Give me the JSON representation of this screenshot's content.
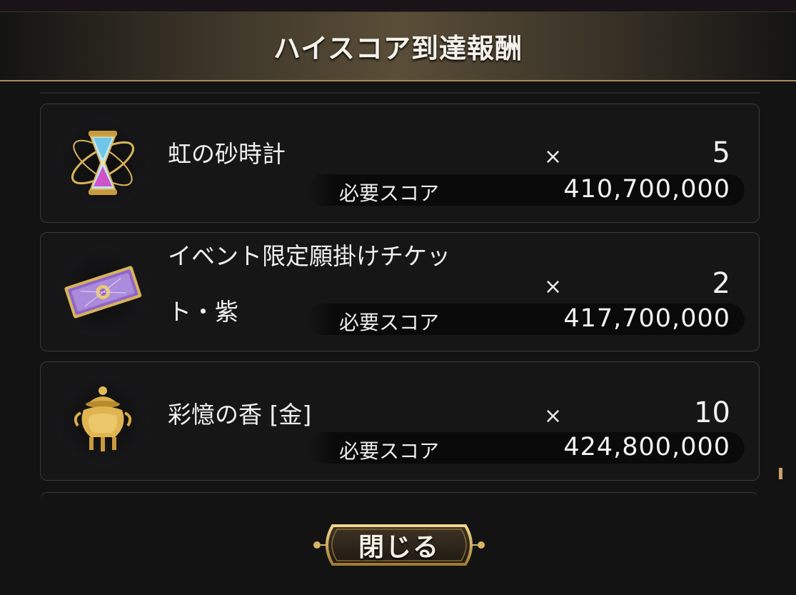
{
  "dialog": {
    "title": "ハイスコア到達報酬",
    "close_label": "閉じる"
  },
  "rewards": [
    {
      "name_line1": "虹の砂時計",
      "name_line2": "",
      "times": "×",
      "quantity": "5",
      "score_label": "必要スコア",
      "required_score": "410,700,000",
      "icon": "hourglass-icon"
    },
    {
      "name_line1": "イベント限定願掛けチケッ",
      "name_line2": "ト・紫",
      "times": "×",
      "quantity": "2",
      "score_label": "必要スコア",
      "required_score": "417,700,000",
      "icon": "ticket-icon"
    },
    {
      "name_line1": "彩憶の香 [金]",
      "name_line2": "",
      "times": "×",
      "quantity": "10",
      "score_label": "必要スコア",
      "required_score": "424,800,000",
      "icon": "incense-burner-icon"
    }
  ],
  "colors": {
    "header_gold": "#5a4e38",
    "accent_gold": "#a48c5e",
    "panel": "#131314",
    "card": "#161617",
    "score_bar": "#0a0a0b"
  }
}
